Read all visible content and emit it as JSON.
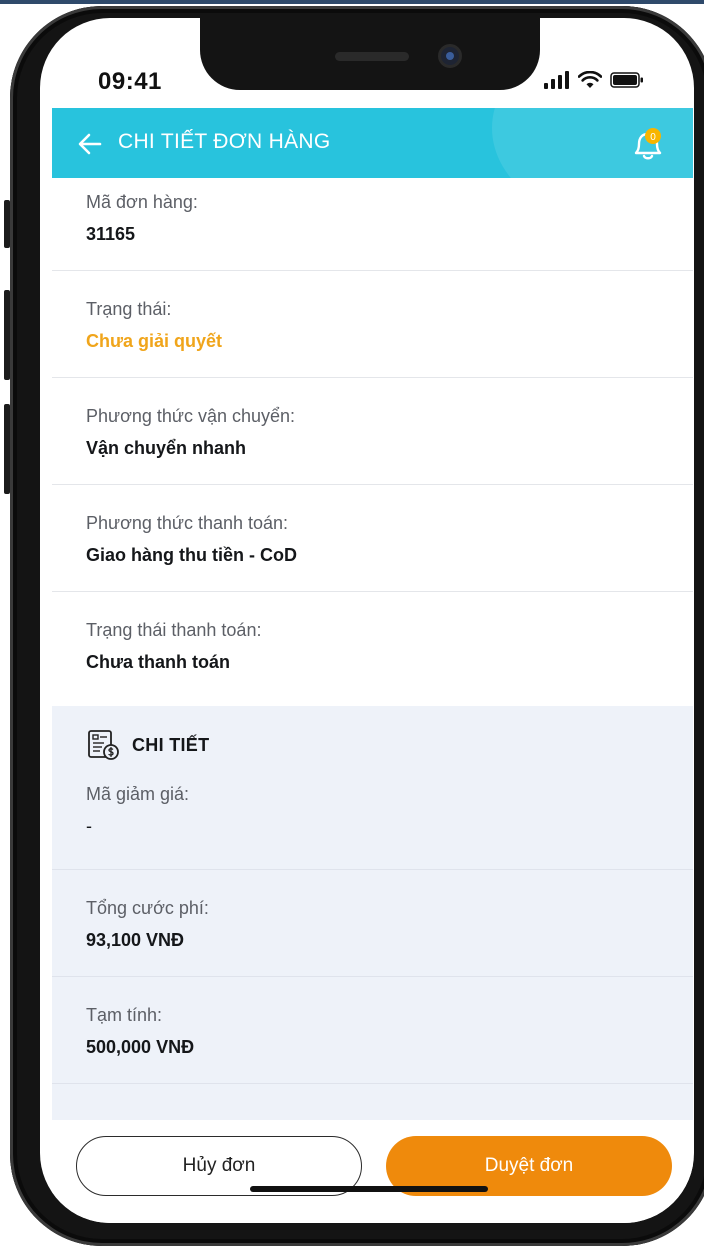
{
  "colors": {
    "header_bg": "#28c3dd",
    "accent_orange": "#ef8a0c",
    "pending_status": "#f0a51b",
    "details_bg": "#eef2f9",
    "notification_badge": "#f7b500"
  },
  "status_bar": {
    "time": "09:41",
    "icons": [
      "signal-icon",
      "wifi-icon",
      "battery-icon"
    ]
  },
  "header": {
    "title": "CHI TIẾT ĐƠN HÀNG",
    "back_icon": "arrow-left-icon",
    "notification_icon": "bell-icon",
    "notification_count": "0"
  },
  "order": {
    "fields": [
      {
        "label": "Mã đơn hàng:",
        "value": "31165"
      },
      {
        "label": "Trạng thái:",
        "value": "Chưa giải quyết"
      },
      {
        "label": "Phương thức vận chuyển:",
        "value": "Vận chuyển nhanh"
      },
      {
        "label": "Phương thức thanh toán:",
        "value": "Giao hàng thu tiền - CoD"
      },
      {
        "label": "Trạng thái thanh toán:",
        "value": "Chưa thanh toán"
      }
    ]
  },
  "details": {
    "title": "CHI TIẾT",
    "icon": "invoice-icon",
    "fields": [
      {
        "label": "Mã giảm giá:",
        "value": "-"
      },
      {
        "label": "Tổng cước phí:",
        "value": "93,100 VNĐ"
      },
      {
        "label": "Tạm tính:",
        "value": "500,000 VNĐ"
      }
    ]
  },
  "actions": {
    "cancel_label": "Hủy đơn",
    "approve_label": "Duyệt đơn"
  }
}
